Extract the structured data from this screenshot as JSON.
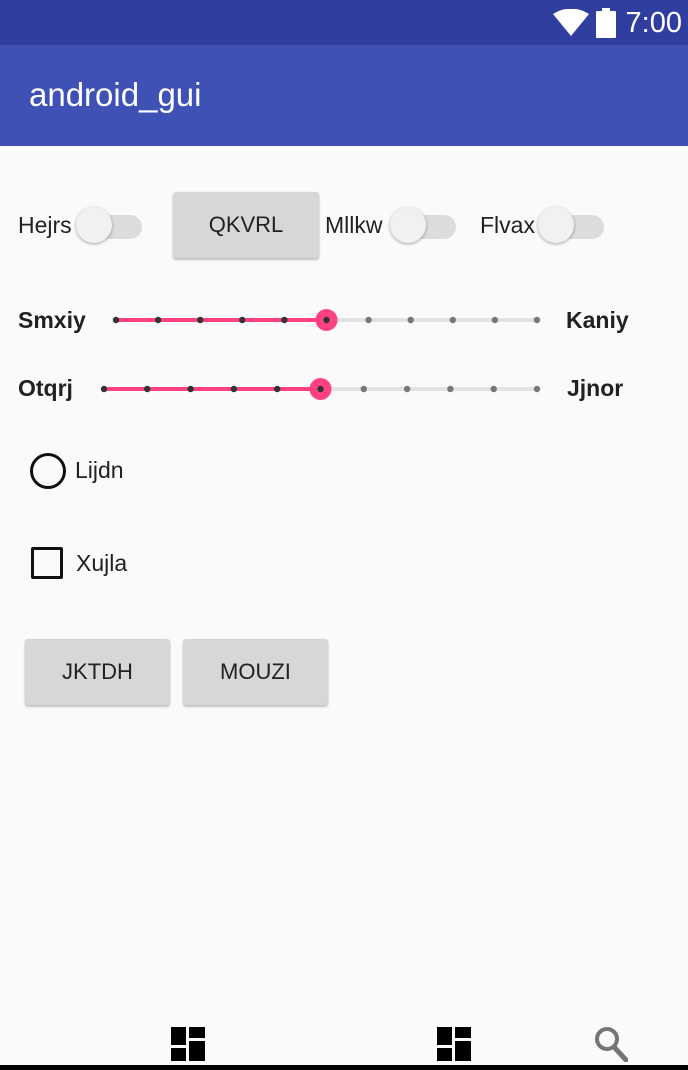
{
  "status_bar": {
    "time": "7:00"
  },
  "app_bar": {
    "title": "android_gui"
  },
  "row1": {
    "switch1_label": "Hejrs",
    "button_label": "QKVRL",
    "switch2_label": "Mllkw",
    "switch3_label": "Flvax"
  },
  "slider1": {
    "start_label": "Smxiy",
    "end_label": "Kaniy",
    "steps": 10,
    "value": 5
  },
  "slider2": {
    "start_label": "Otqrj",
    "end_label": "Jjnor",
    "steps": 10,
    "value": 5
  },
  "radio": {
    "label": "Lijdn"
  },
  "checkbox": {
    "label": "Xujla"
  },
  "buttons": {
    "left_label": "JKTDH",
    "right_label": "MOUZI"
  },
  "colors": {
    "accent": "#ff4081",
    "status_bar": "#303f9f",
    "app_bar": "#3f51b5"
  },
  "icons": [
    "wifi-icon",
    "battery-icon",
    "dashboard-icon",
    "dashboard-icon",
    "search-icon"
  ]
}
